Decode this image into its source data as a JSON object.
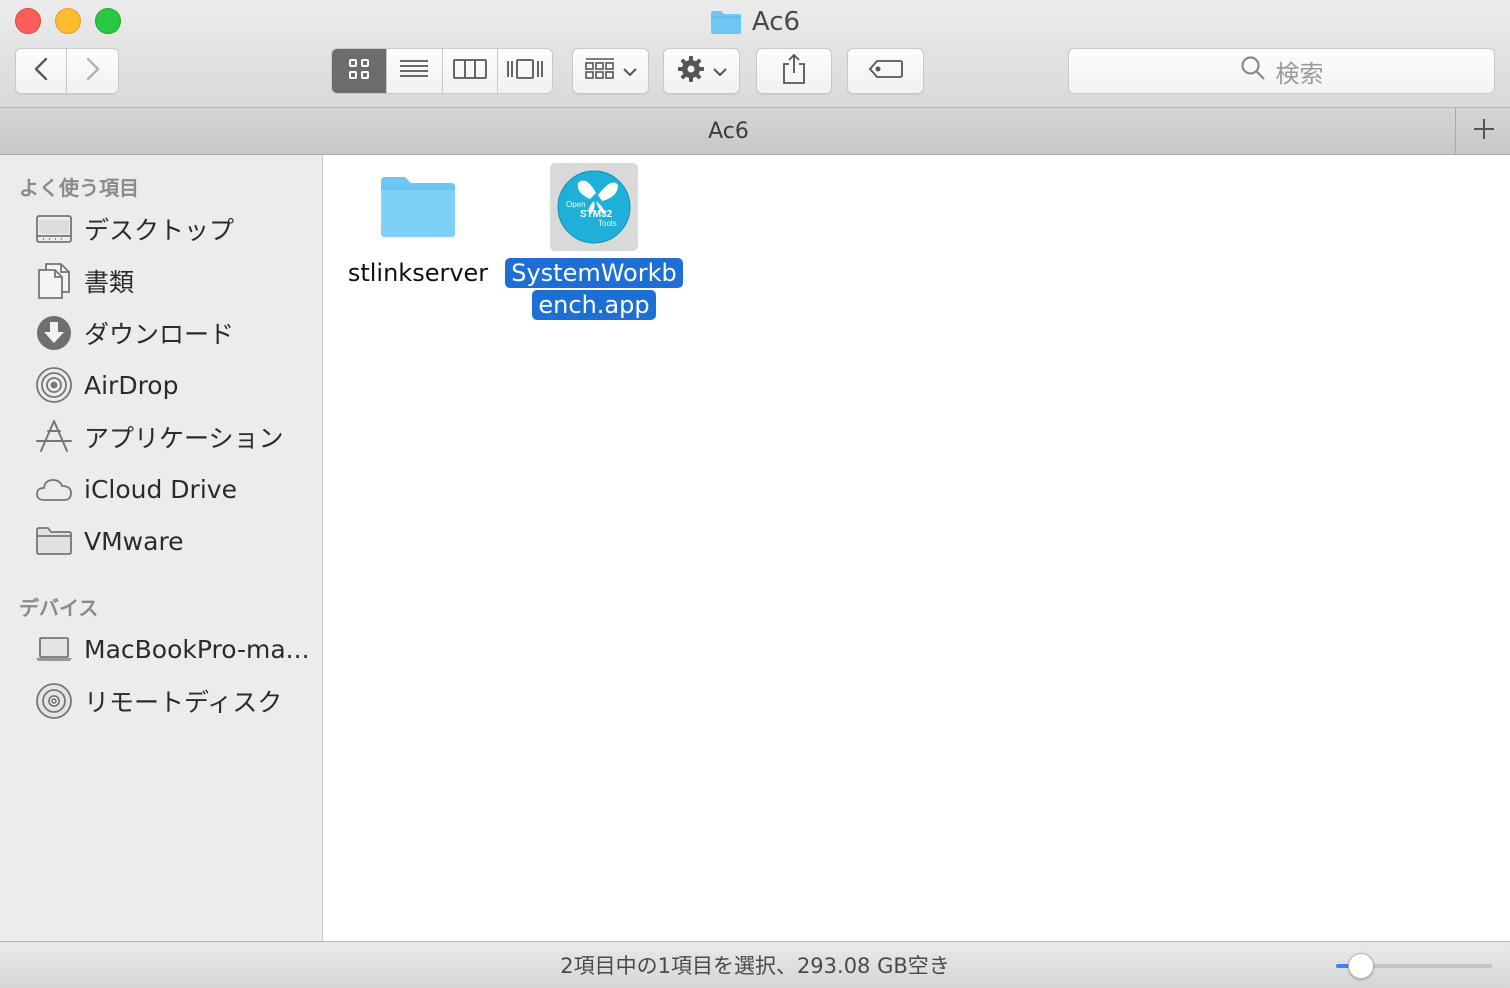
{
  "window": {
    "title": "Ac6",
    "title_icon": "folder-icon"
  },
  "toolbar": {
    "back_icon": "chevron-left-icon",
    "forward_icon": "chevron-right-icon",
    "view_modes": [
      {
        "name": "icon-view",
        "icon": "grid-icon",
        "active": true
      },
      {
        "name": "list-view",
        "icon": "list-icon",
        "active": false
      },
      {
        "name": "column-view",
        "icon": "columns-icon",
        "active": false
      },
      {
        "name": "coverflow-view",
        "icon": "coverflow-icon",
        "active": false
      }
    ],
    "arrange_icon": "arrange-grid-icon",
    "action_icon": "gear-icon",
    "share_icon": "share-icon",
    "tag_icon": "tag-icon",
    "search_placeholder": "検索"
  },
  "pathbar": {
    "tab_label": "Ac6",
    "add_tab_icon": "plus-icon"
  },
  "sidebar": {
    "favorites_header": "よく使う項目",
    "favorites": [
      {
        "label": "デスクトップ",
        "icon": "desktop-icon"
      },
      {
        "label": "書類",
        "icon": "documents-icon"
      },
      {
        "label": "ダウンロード",
        "icon": "downloads-icon"
      },
      {
        "label": "AirDrop",
        "icon": "airdrop-icon"
      },
      {
        "label": "アプリケーション",
        "icon": "applications-icon"
      },
      {
        "label": "iCloud Drive",
        "icon": "cloud-icon"
      },
      {
        "label": "VMware",
        "icon": "folder-icon"
      }
    ],
    "devices_header": "デバイス",
    "devices": [
      {
        "label": "MacBookPro-ma...",
        "icon": "laptop-icon"
      },
      {
        "label": "リモートディスク",
        "icon": "disc-icon"
      }
    ]
  },
  "content": {
    "files": [
      {
        "name": "stlinkserver",
        "icon": "folder-icon",
        "selected": false
      },
      {
        "name_line1": "SystemWorkb",
        "name_line2": "ench.app",
        "icon": "openstm32-app-icon",
        "selected": true,
        "icon_text": "Open STM32 Tools"
      }
    ]
  },
  "statusbar": {
    "text": "2項目中の1項目を選択、293.08 GB空き",
    "zoom_level": 0.16
  },
  "colors": {
    "selection": "#1d6ed5",
    "folder": "#6dc6f4",
    "close": "#fc5f57",
    "minimize": "#fdbc2e",
    "maximize": "#28c840"
  }
}
